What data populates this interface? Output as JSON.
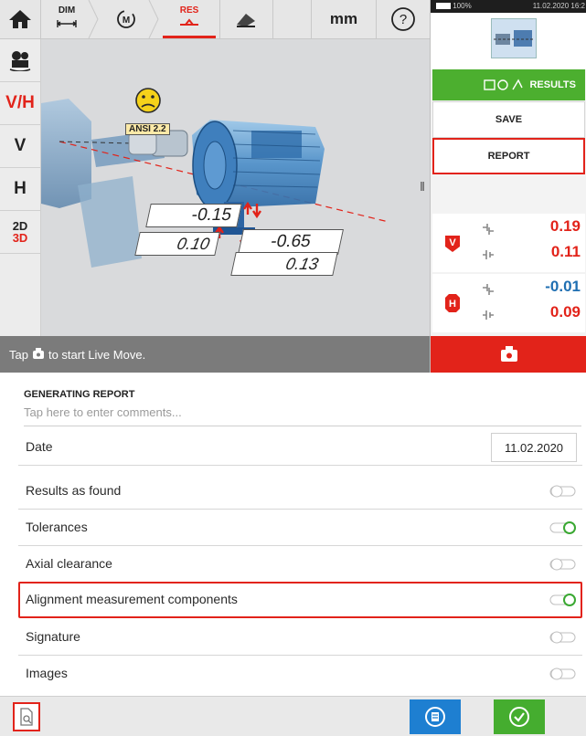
{
  "toolbar": {
    "home_icon": "home-icon",
    "dim_label": "DIM",
    "measure_label": "M",
    "res_label": "RES",
    "unit_label": "mm",
    "help_label": "?"
  },
  "sidebar": {
    "vh_label": "V/H",
    "v_label": "V",
    "h_label": "H",
    "view_2d_label": "2D",
    "view_3d_label": "3D"
  },
  "scene": {
    "tolerance_label": "ANSI 2.2",
    "vertical_front_foot": "-0.15",
    "vertical_back_foot": "-0.65",
    "horizontal_front_foot": "0.10",
    "horizontal_back_foot": "0.13"
  },
  "status": {
    "text_prefix": "Tap",
    "text_suffix": "to start Live Move."
  },
  "system_bar": {
    "battery": "100%",
    "datetime": "11.02.2020 16:2"
  },
  "right_panel": {
    "results_label": "RESULTS",
    "save_label": "SAVE",
    "report_label": "REPORT",
    "vertical": {
      "offset": "0.19",
      "angularity": "0.11"
    },
    "horizontal": {
      "offset": "-0.01",
      "angularity": "0.09"
    },
    "vertical_badge": "V",
    "horizontal_badge": "H"
  },
  "report": {
    "title": "GENERATING REPORT",
    "comments_placeholder": "Tap here to enter comments...",
    "date_label": "Date",
    "date_value": "11.02.2020",
    "rows": [
      {
        "label": "Results as found",
        "on": false
      },
      {
        "label": "Tolerances",
        "on": true
      },
      {
        "label": "Axial clearance",
        "on": false
      },
      {
        "label": "Alignment measurement components",
        "on": true
      },
      {
        "label": "Signature",
        "on": false
      },
      {
        "label": "Images",
        "on": false
      }
    ]
  },
  "colors": {
    "accent_red": "#e2231a",
    "accent_green": "#45ad2f",
    "accent_blue": "#1e7fd1",
    "value_red": "#e2231a",
    "value_blue": "#1f6fb2"
  }
}
